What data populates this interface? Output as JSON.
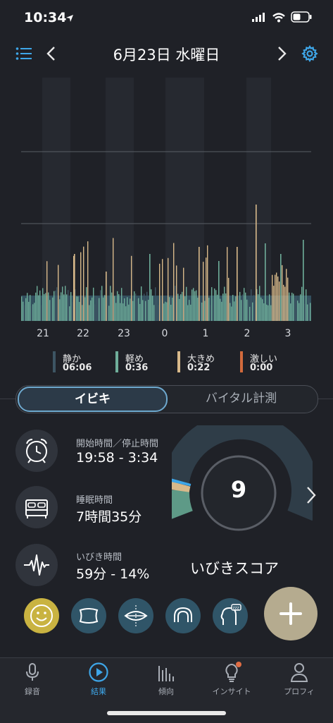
{
  "status": {
    "time": "10:34"
  },
  "header": {
    "title": "6月23日 水曜日"
  },
  "chart_data": {
    "type": "bar",
    "x_ticks": [
      "21",
      "22",
      "23",
      "0",
      "1",
      "2",
      "3"
    ],
    "legend": [
      {
        "name": "静か",
        "value": "06:06",
        "color": "#3d5563"
      },
      {
        "name": "軽め",
        "value": "0:36",
        "color": "#6fae9a"
      },
      {
        "name": "大きめ",
        "value": "0:22",
        "color": "#d8b98a"
      },
      {
        "name": "激しい",
        "value": "0:00",
        "color": "#d26a3c"
      }
    ]
  },
  "tabs": [
    {
      "label": "イビキ"
    },
    {
      "label": "バイタル計測"
    }
  ],
  "stats": [
    {
      "label": "開始時間／停止時間",
      "value": "19:58 - 3:34"
    },
    {
      "label": "睡眠時間",
      "value": "7時間35分"
    },
    {
      "label": "いびき時間",
      "value": "59分 - 14%"
    }
  ],
  "score": {
    "value": "9",
    "label": "いびきスコア"
  },
  "bottom_nav": [
    {
      "label": "録音"
    },
    {
      "label": "結果"
    },
    {
      "label": "傾向"
    },
    {
      "label": "インサイト"
    },
    {
      "label": "プロフィ"
    }
  ]
}
